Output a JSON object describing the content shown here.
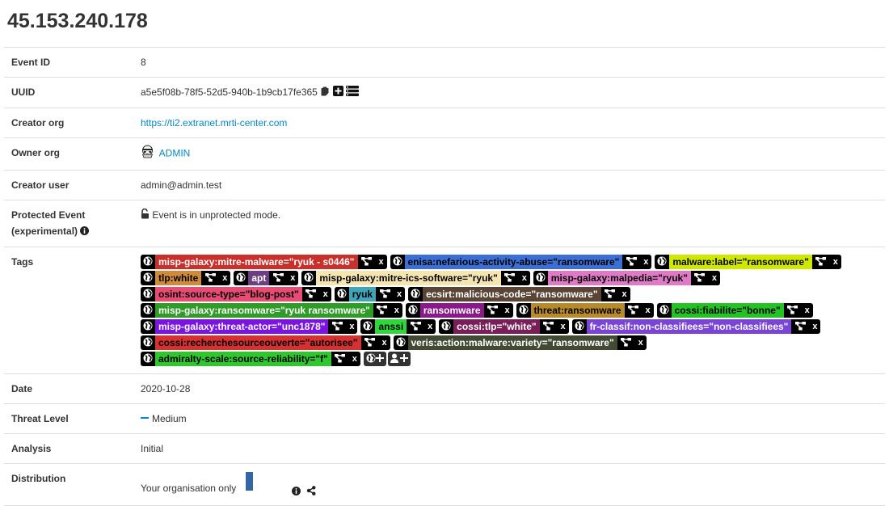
{
  "page_title": "45.153.240.178",
  "labels": {
    "event_id": "Event ID",
    "uuid": "UUID",
    "creator_org": "Creator org",
    "owner_org": "Owner org",
    "creator_user": "Creator user",
    "protected_event": "Protected Event",
    "protected_event_sub": "(experimental)",
    "tags": "Tags",
    "date": "Date",
    "threat_level": "Threat Level",
    "analysis": "Analysis",
    "distribution": "Distribution"
  },
  "values": {
    "event_id": "8",
    "uuid": "a5e5f08b-78f5-52d5-940b-1b9cb17fe365",
    "creator_org": "https://ti2.extranet.mrti-center.com",
    "owner_org": "ADMIN",
    "creator_user": "admin@admin.test",
    "protected_event": "Event is in unprotected mode.",
    "date": "2020-10-28",
    "threat_level": "Medium",
    "analysis": "Initial",
    "distribution": "Your organisation only"
  },
  "tag_rows": [
    [
      {
        "name": "misp-galaxy:mitre-malware=\"ryuk - s0446\"",
        "bg": "#c9302c",
        "fg": "#ffffff"
      },
      {
        "name": "enisa:nefarious-activity-abuse=\"ransomware\"",
        "bg": "#3c6fd6",
        "fg": "#000000"
      },
      {
        "name": "malware:label=\"ransomware\"",
        "bg": "#cfe800",
        "fg": "#000000"
      }
    ],
    [
      {
        "name": "tlp:white",
        "bg": "#d08b3a",
        "fg": "#000000"
      },
      {
        "name": "apt",
        "bg": "#6d3f82",
        "fg": "#ffffff"
      },
      {
        "name": "misp-galaxy:mitre-ics-software=\"ryuk\"",
        "bg": "#f5e5b0",
        "fg": "#000000"
      },
      {
        "name": "misp-galaxy:malpedia=\"ryuk\"",
        "bg": "#e07ac7",
        "fg": "#000000"
      }
    ],
    [
      {
        "name": "osint:source-type=\"blog-post\"",
        "bg": "#e84b74",
        "fg": "#000000"
      },
      {
        "name": "ryuk",
        "bg": "#3ea6b8",
        "fg": "#000000"
      },
      {
        "name": "ecsirt:malicious-code=\"ransomware\"",
        "bg": "#5a4436",
        "fg": "#ffffff"
      }
    ],
    [
      {
        "name": "misp-galaxy:ransomware=\"ryuk ransomware\"",
        "bg": "#2f9c28",
        "fg": "#ffffff"
      },
      {
        "name": "ransomware",
        "bg": "#8a1a8a",
        "fg": "#ffffff"
      },
      {
        "name": "threat:ransomware",
        "bg": "#b98a2a",
        "fg": "#000000"
      },
      {
        "name": "cossi:fiabilite=\"bonne\"",
        "bg": "#22c322",
        "fg": "#000000"
      }
    ],
    [
      {
        "name": "misp-galaxy:threat-actor=\"unc1878\"",
        "bg": "#7b14e0",
        "fg": "#ffffff"
      },
      {
        "name": "anssi",
        "bg": "#2fd83a",
        "fg": "#000000"
      },
      {
        "name": "cossi:tlp=\"white\"",
        "bg": "#7a1e5a",
        "fg": "#ffffff"
      },
      {
        "name": "fr-classif:non-classifiees=\"non-classifiees\"",
        "bg": "#7a45d6",
        "fg": "#ffffff"
      }
    ],
    [
      {
        "name": "cossi:recherchesourceouverte=\"autorisee\"",
        "bg": "#d63030",
        "fg": "#000000"
      },
      {
        "name": "veris:action:malware:variety=\"ransomware\"",
        "bg": "#424a33",
        "fg": "#ffffff"
      }
    ],
    [
      {
        "name": "admiralty-scale:source-reliability=\"f\"",
        "bg": "#2ec82e",
        "fg": "#000000"
      }
    ]
  ],
  "icons": {
    "globe": "globe-icon",
    "relation": "sitemap-icon",
    "remove": "x",
    "add_global": "globe-plus-icon",
    "add_local": "user-plus-icon",
    "copy": "clipboard-icon",
    "add": "plus-square-icon",
    "list": "list-icon",
    "owner_avatar": "stormtrooper-icon",
    "unlock": "unlock-icon",
    "info": "info-circle-icon",
    "share": "share-alt-icon"
  },
  "colors": {
    "link": "#0088cc",
    "distribution_bar": "#3465a4",
    "threat_medium": "#0088cc"
  }
}
